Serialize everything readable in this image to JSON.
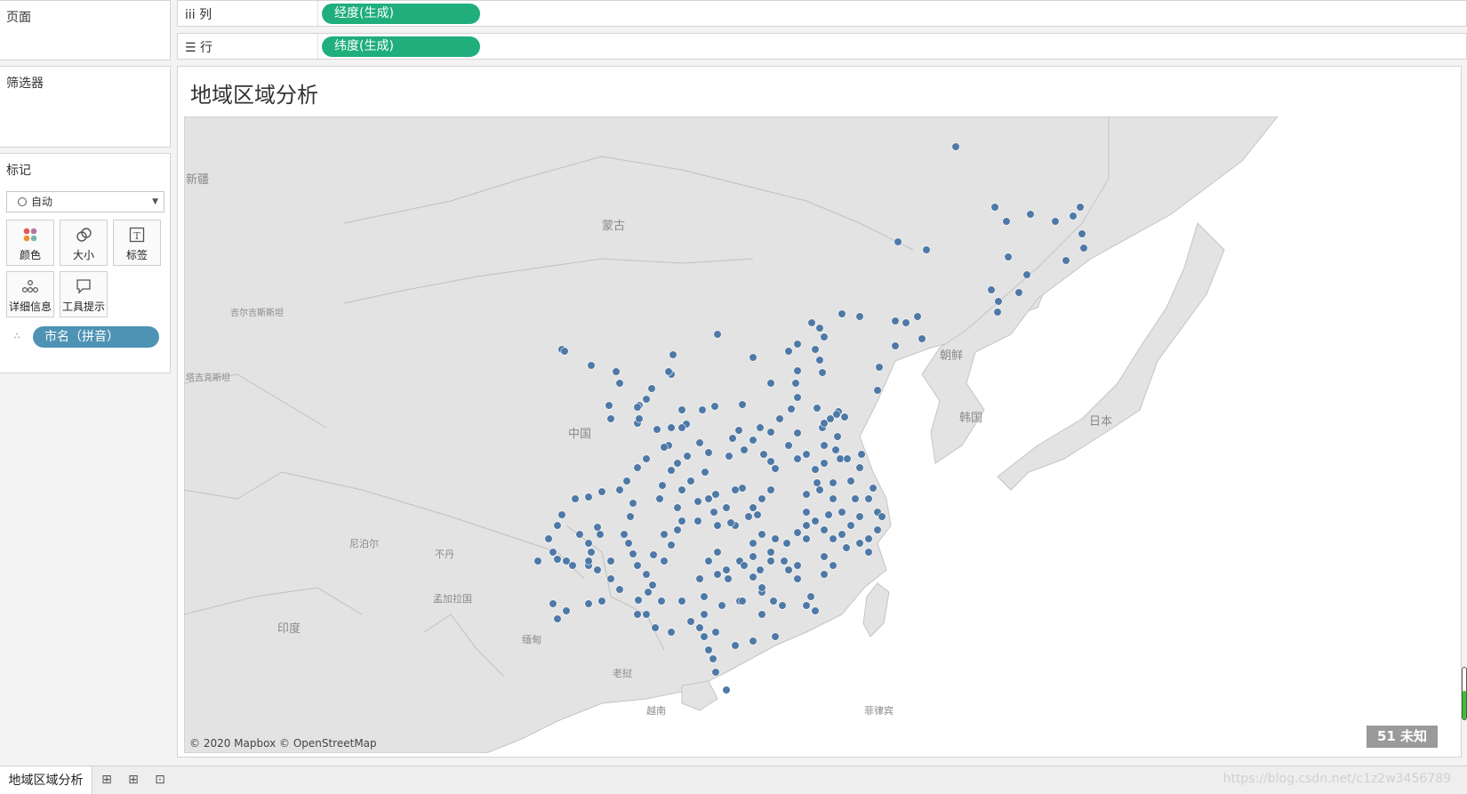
{
  "left_panel": {
    "pages_title": "页面",
    "filters_title": "筛选器",
    "marks_title": "标记",
    "mark_type": "自动",
    "mark_buttons": [
      {
        "label": "颜色",
        "icon": "color-dots-icon"
      },
      {
        "label": "大小",
        "icon": "size-icon"
      },
      {
        "label": "标签",
        "icon": "label-icon"
      },
      {
        "label": "详细信息",
        "icon": "detail-icon"
      },
      {
        "label": "工具提示",
        "icon": "tooltip-icon"
      }
    ],
    "detail_pill": "市名（拼音）"
  },
  "shelves": {
    "columns_label": "列",
    "columns_pill": "经度(生成)",
    "rows_label": "行",
    "rows_pill": "纬度(生成)"
  },
  "view": {
    "title": "地域区域分析",
    "attribution": "© 2020 Mapbox © OpenStreetMap",
    "unknown_badge": "51 未知",
    "map_labels": [
      "蒙古",
      "中国",
      "印度",
      "日本",
      "朝鲜",
      "韩国",
      "新疆",
      "吉尔吉斯斯坦",
      "塔吉克斯坦",
      "尼泊尔",
      "不丹",
      "孟加拉国",
      "缅甸",
      "老挝",
      "越南",
      "菲律宾"
    ],
    "accent_color": "#4e79a7",
    "green_pill_color": "#1fae7c",
    "detail_pill_color": "#4e93b4"
  },
  "tabs": {
    "active": "地域区域分析",
    "icons": [
      "new-worksheet-icon",
      "new-dashboard-icon",
      "new-story-icon"
    ]
  },
  "watermark": "https://blog.csdn.net/c1z2w3456789"
}
